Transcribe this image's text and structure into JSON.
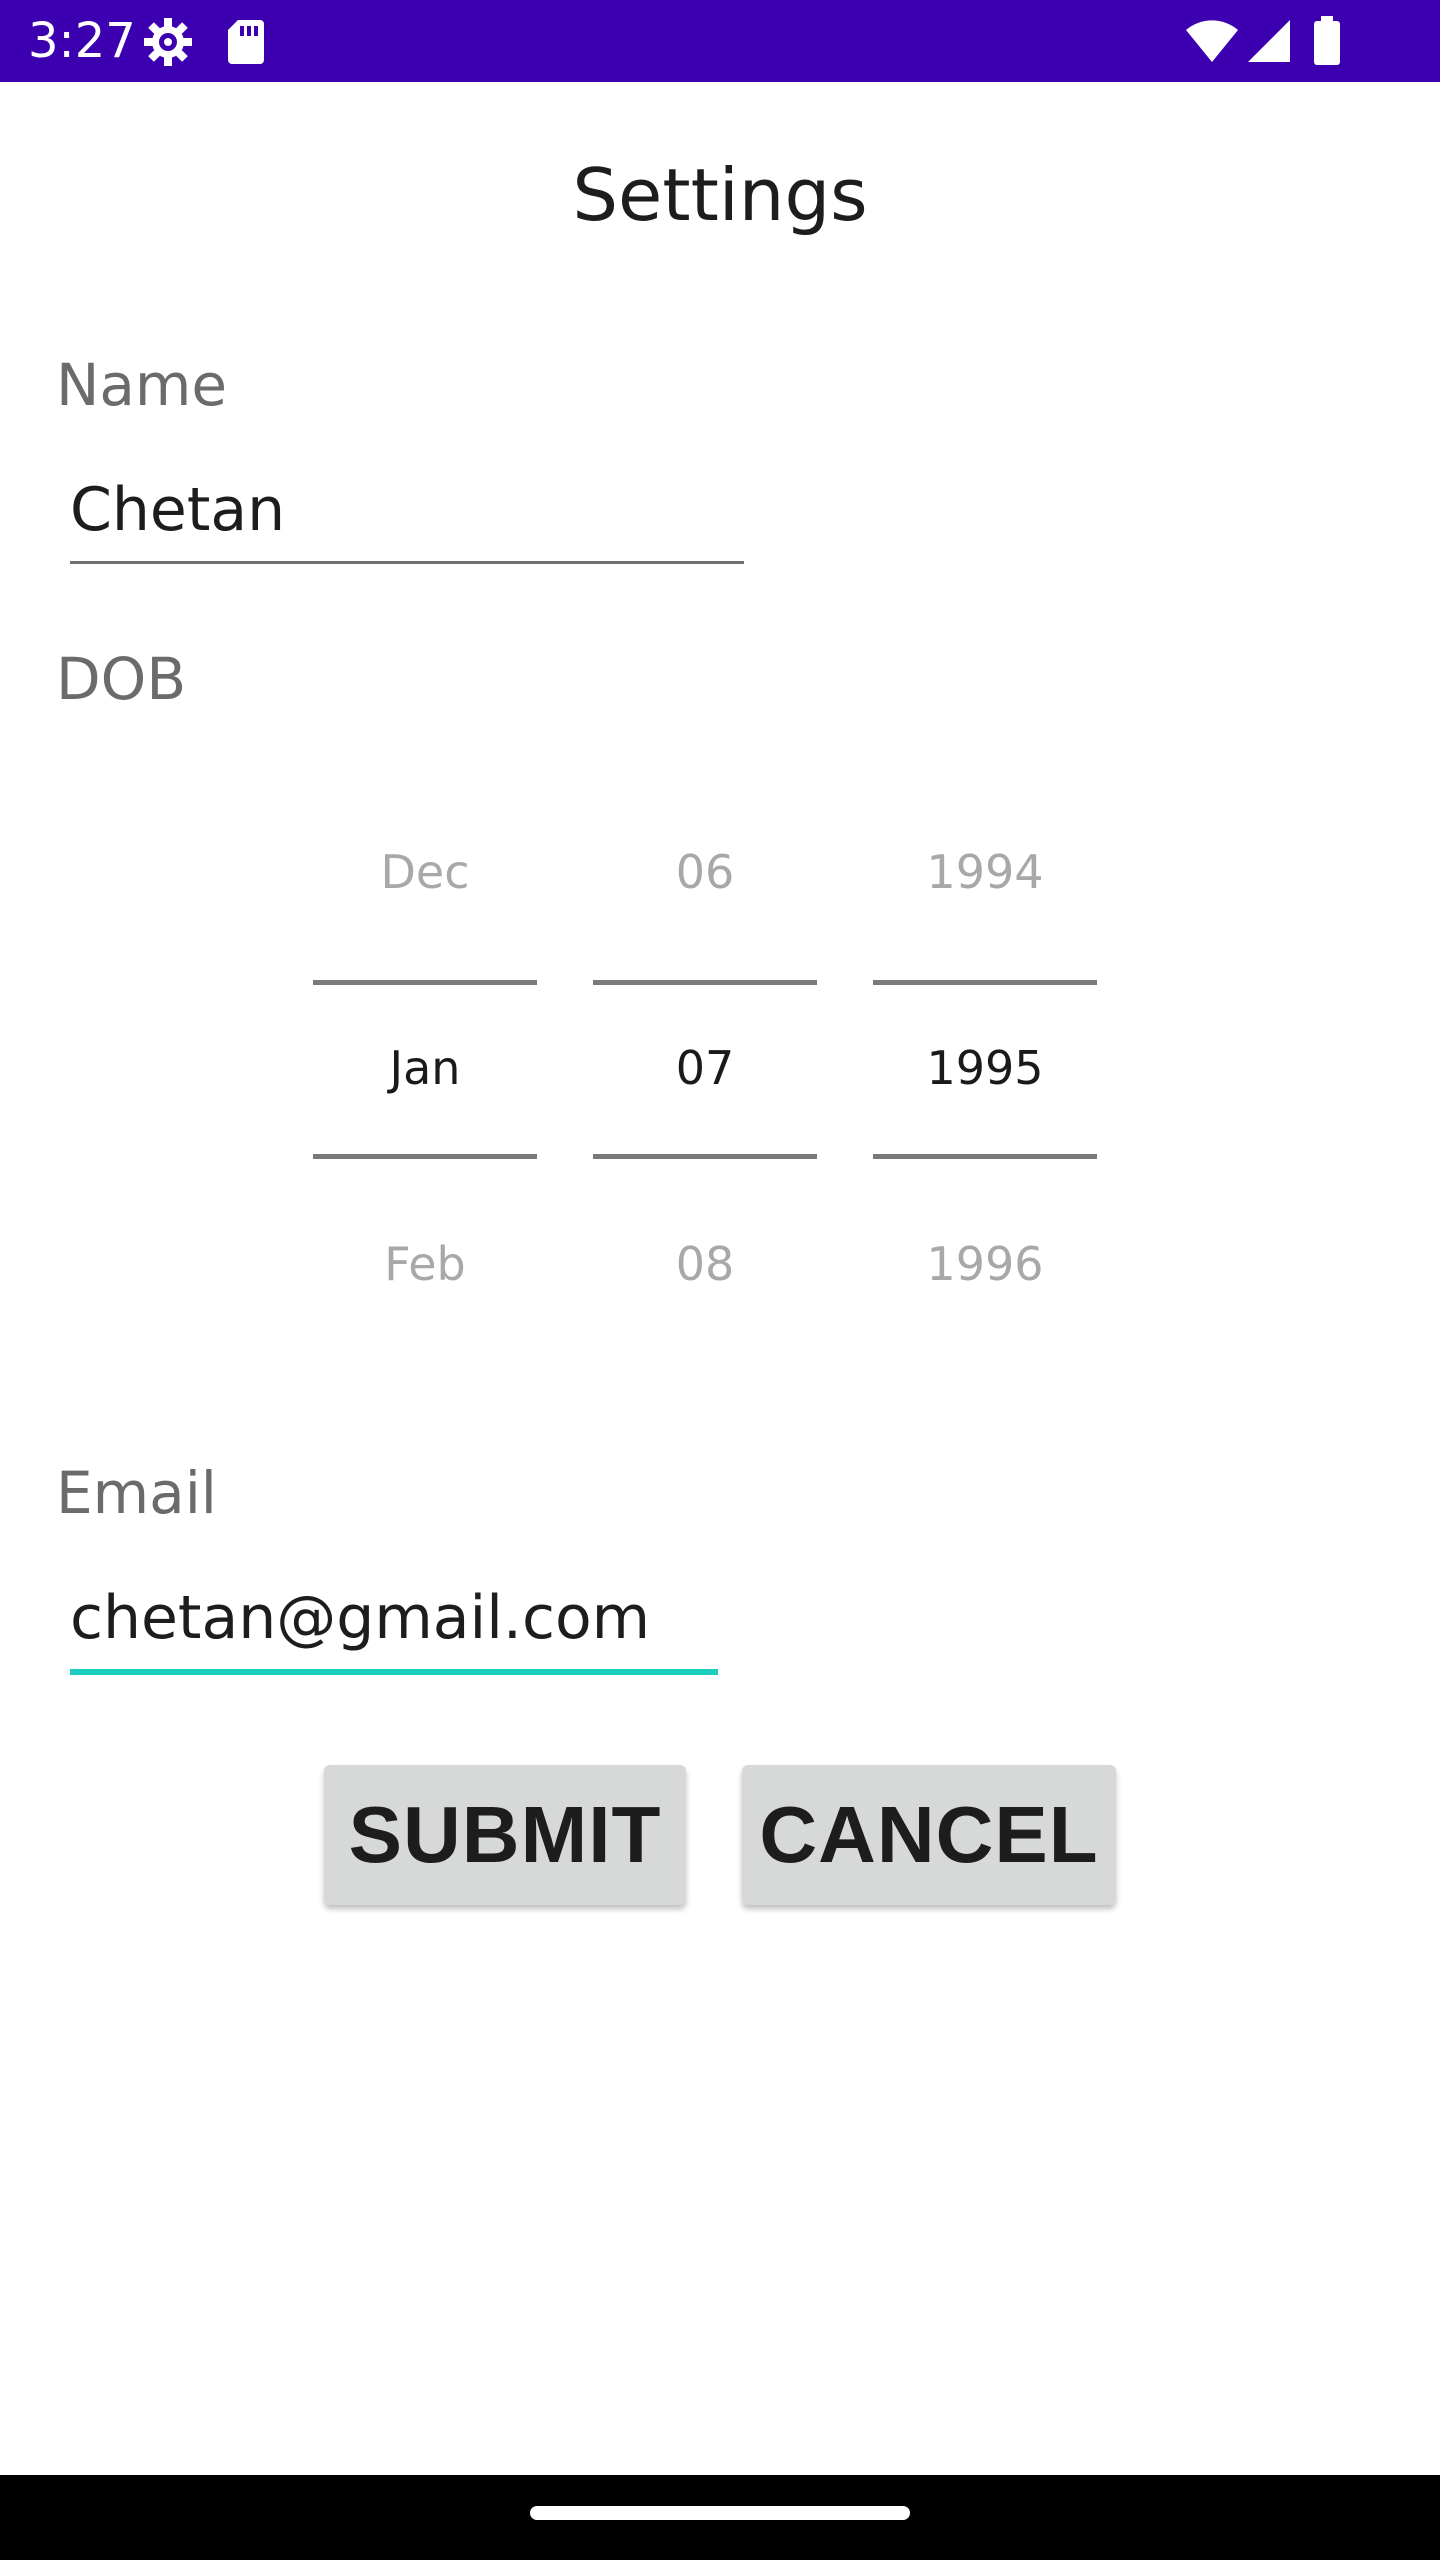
{
  "status_bar": {
    "time": "3:27",
    "background": "#3d00b1",
    "icons": [
      "settings-gear-icon",
      "sd-card-icon",
      "wifi-icon",
      "signal-icon",
      "battery-icon"
    ]
  },
  "page": {
    "title": "Settings"
  },
  "form": {
    "name": {
      "label": "Name",
      "value": "Chetan"
    },
    "dob": {
      "label": "DOB",
      "month": {
        "prev": "Dec",
        "selected": "Jan",
        "next": "Feb"
      },
      "day": {
        "prev": "06",
        "selected": "07",
        "next": "08"
      },
      "year": {
        "prev": "1994",
        "selected": "1995",
        "next": "1996"
      }
    },
    "email": {
      "label": "Email",
      "value": "chetan@gmail.com",
      "focus_color": "#1ccfbc"
    }
  },
  "actions": {
    "submit_label": "SUBMIT",
    "cancel_label": "CANCEL"
  },
  "nav_bar": {
    "home_indicator": "home-indicator"
  }
}
